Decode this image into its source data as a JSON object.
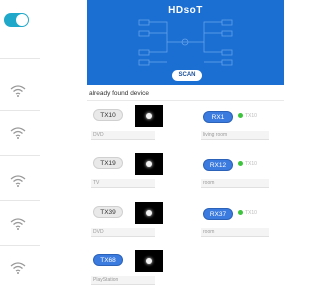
{
  "hero": {
    "title": "HDsoT",
    "scan_label": "SCAN"
  },
  "found_label": "already found device",
  "wifi_toggle": {
    "state": "on",
    "color": "#1fa8c9"
  },
  "wifi_items": 5,
  "rows": [
    {
      "tx_label": "TX10",
      "tx_name": "DVD",
      "tx_active": false,
      "rx_label": "RX1",
      "rx_status": "TX10",
      "rx_name": "living room"
    },
    {
      "tx_label": "TX19",
      "tx_name": "TV",
      "tx_active": false,
      "rx_label": "RX12",
      "rx_status": "TX10",
      "rx_name": "room"
    },
    {
      "tx_label": "TX39",
      "tx_name": "DVD",
      "tx_active": false,
      "rx_label": "RX37",
      "rx_status": "TX10",
      "rx_name": "room"
    },
    {
      "tx_label": "TX68",
      "tx_name": "PlayStation",
      "tx_active": true
    }
  ],
  "colors": {
    "hero_bg": "#1b6fd3",
    "pill_active": "#3b7be0",
    "status_dot": "#3cc43c"
  }
}
